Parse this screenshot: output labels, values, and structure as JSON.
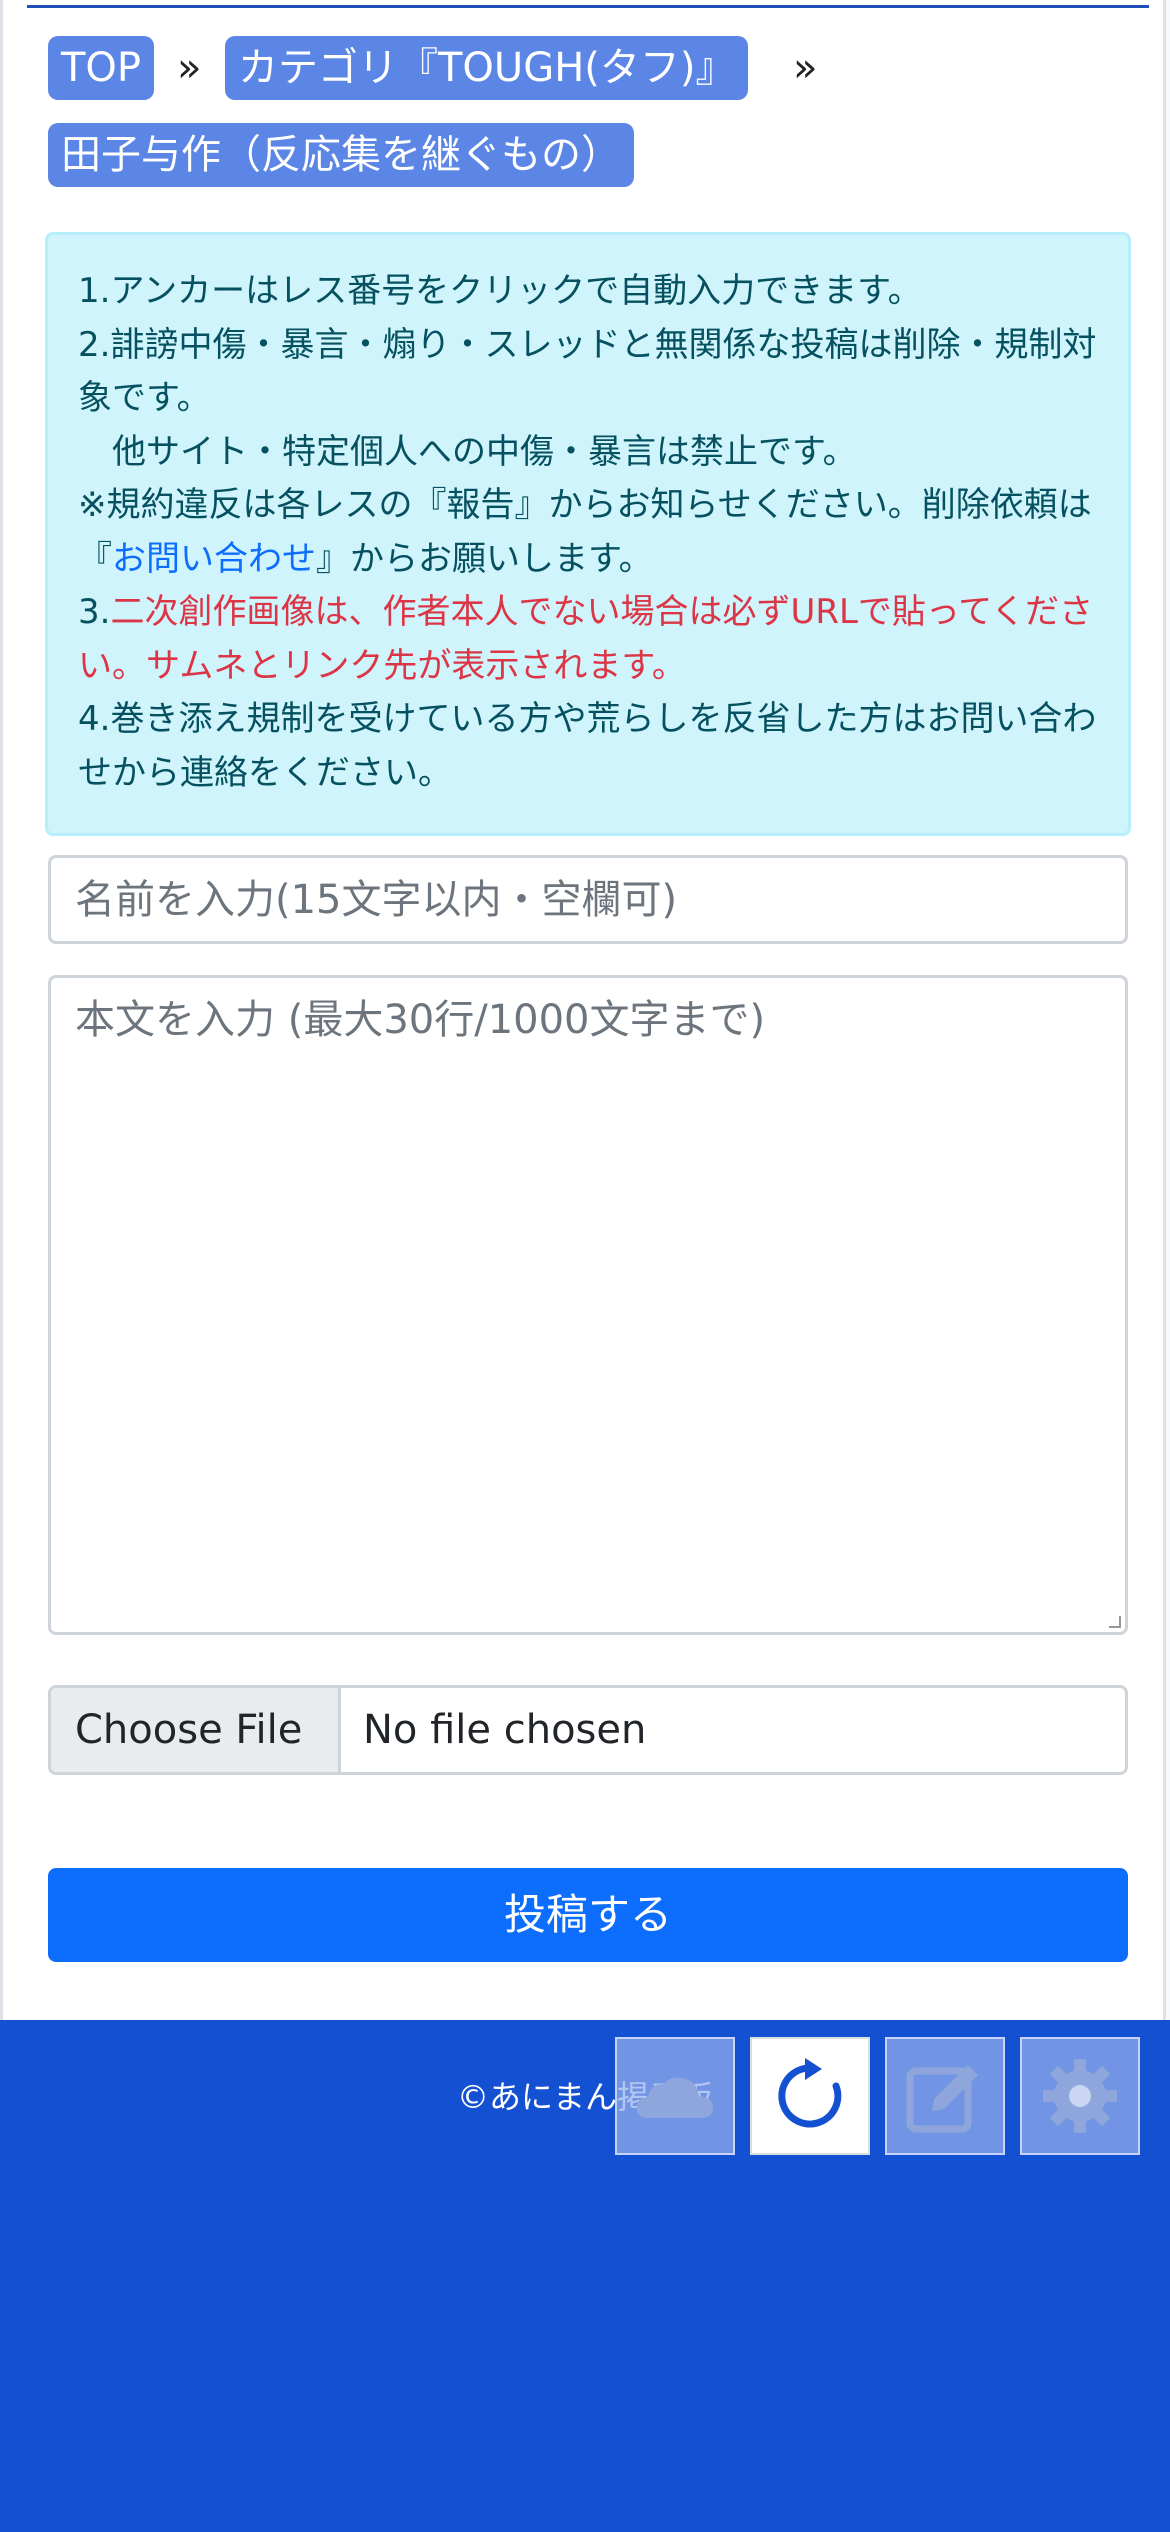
{
  "breadcrumb": {
    "items": [
      "TOP",
      "カテゴリ『TOUGH(タフ)』",
      "田子与作（反応集を継ぐもの）"
    ],
    "separator": "»"
  },
  "notice": {
    "line1": "1.アンカーはレス番号をクリックで自動入力できます。",
    "line2": "2.誹謗中傷・暴言・煽り・スレッドと無関係な投稿は削除・規制対象です。",
    "line3": "他サイト・特定個人への中傷・暴言は禁止です。",
    "line4_prefix": "※規約違反は各レスの『報告』からお知らせください。削除依頼は『",
    "line4_link": "お問い合わせ",
    "line4_suffix": "』からお願いします。",
    "line5_prefix": "3.",
    "line5_red": "二次創作画像は、作者本人でない場合は必ずURLで貼ってください。サムネとリンク先が表示されます。",
    "line6": "4.巻き添え規制を受けている方や荒らしを反省した方はお問い合わせから連絡をください。"
  },
  "form": {
    "name_placeholder": "名前を入力(15文字以内・空欄可)",
    "body_placeholder": "本文を入力 (最大30行/1000文字まで)",
    "file_button": "Choose File",
    "file_status": "No file chosen",
    "submit_label": "投稿する"
  },
  "footer": {
    "copyright": "©あにまん掲示板"
  },
  "fab_buttons": [
    {
      "icon": "cloud-upload-icon"
    },
    {
      "icon": "refresh-icon",
      "active": true
    },
    {
      "icon": "edit-icon"
    },
    {
      "icon": "gear-icon"
    }
  ],
  "colors": {
    "accent": "#0d6efd",
    "footer": "#1450d2",
    "breadcrumb": "#5b86e5",
    "notice_bg": "#cff4fc",
    "warning_red": "#dc3545"
  }
}
